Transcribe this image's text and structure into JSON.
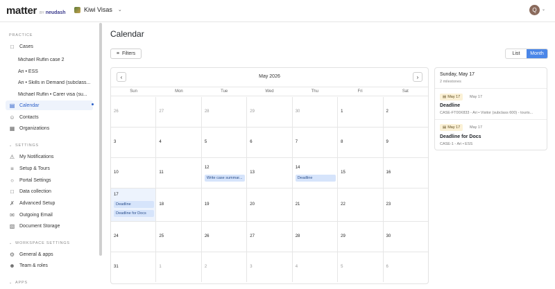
{
  "app": {
    "brand": "matter",
    "brand_by": "BY",
    "brand_sub": "neudash",
    "workspace": "Kiwi Visas",
    "avatar_initial": "Q"
  },
  "sidebar": {
    "practice_label": "PRACTICE",
    "cases_label": "Cases",
    "case_items": [
      "Michael Ruflin case 2",
      "Ari • ESS",
      "Ari • Skills in Demand (subclass...",
      "Michael Ruflin • Carer visa (su..."
    ],
    "calendar_label": "Calendar",
    "contacts_label": "Contacts",
    "organizations_label": "Organizations",
    "settings_label": "SETTINGS",
    "settings_items": [
      "My Notifications",
      "Setup & Tours",
      "Portal Settings",
      "Data collection",
      "Advanced Setup",
      "Outgoing Email",
      "Document Storage"
    ],
    "workspace_settings_label": "WORKSPACE SETTINGS",
    "workspace_items": [
      "General & apps",
      "Team & roles"
    ],
    "apps_label": "APPS"
  },
  "main": {
    "title": "Calendar",
    "filters_label": "Filters",
    "view_list": "List",
    "view_month": "Month"
  },
  "calendar": {
    "month_label": "May 2026",
    "weekdays": [
      "Sun",
      "Mon",
      "Tue",
      "Wed",
      "Thu",
      "Fri",
      "Sat"
    ],
    "weeks": [
      [
        "26",
        "27",
        "28",
        "29",
        "30",
        "1",
        "2"
      ],
      [
        "3",
        "4",
        "5",
        "6",
        "7",
        "8",
        "9"
      ],
      [
        "10",
        "11",
        "12",
        "13",
        "14",
        "15",
        "16"
      ],
      [
        "17",
        "18",
        "19",
        "20",
        "21",
        "22",
        "23"
      ],
      [
        "24",
        "25",
        "26",
        "27",
        "28",
        "29",
        "30"
      ],
      [
        "31",
        "1",
        "2",
        "3",
        "4",
        "5",
        "6"
      ]
    ],
    "events": {
      "may12": "Write case summar...",
      "may14": "Deadline",
      "may17_a": "Deadline",
      "may17_b": "Deadline for Docs"
    }
  },
  "panel": {
    "date": "Sunday, May 17",
    "count": "2 milestones",
    "milestones": [
      {
        "pill": "May 17",
        "date": "May 17",
        "title": "Deadline",
        "sub": "CASE-FT00X833 - Ari • Visitor (subclass 600) - touris..."
      },
      {
        "pill": "May 17",
        "date": "May 17",
        "title": "Deadline for Docs",
        "sub": "CASE-1 - Ari • ESS"
      }
    ]
  },
  "colors": {
    "accent": "#4a86e8",
    "active_bg": "#eef3fc",
    "event_bg": "#d6e4fb",
    "pill_bg": "#fbf1d6",
    "today_bg": "#edf3fd"
  }
}
